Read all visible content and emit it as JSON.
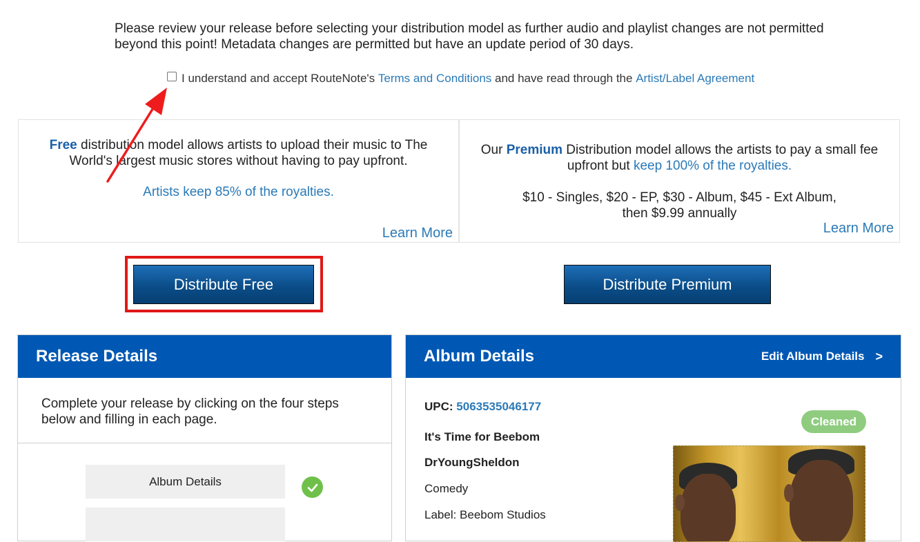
{
  "intro": {
    "line1": "Please review your release before selecting your distribution model as further audio and playlist changes are not permitted",
    "line2": "beyond this point! Metadata changes are permitted but have an update period of 30 days."
  },
  "terms": {
    "text_before": "I understand and accept RouteNote's ",
    "terms_link": "Terms and Conditions",
    "text_middle": " and have read through the ",
    "agreement_link": "Artist/Label Agreement"
  },
  "plans": {
    "free": {
      "name": "Free",
      "desc_line1": " distribution model allows artists to upload their music to The",
      "desc_line2": "World's largest music stores without having to pay upfront.",
      "royalty_text": "Artists keep 85% of the royalties.",
      "learn_more": "Learn More"
    },
    "premium": {
      "prefix": "Our ",
      "name": "Premium",
      "desc_line1": " Distribution model allows the artists to pay a small fee",
      "desc_line2_plain": "upfront but ",
      "desc_line2_link": "keep 100% of the royalties.",
      "pricing_line1": "$10 - Singles, $20 - EP, $30 - Album, $45 - Ext Album,",
      "pricing_line2": "then $9.99 annually",
      "learn_more": "Learn More"
    }
  },
  "buttons": {
    "distribute_free": "Distribute Free",
    "distribute_premium": "Distribute Premium"
  },
  "release_details": {
    "title": "Release Details",
    "intro_line1": "Complete your release by clicking on the four steps",
    "intro_line2": "below and filling in each page.",
    "steps": [
      {
        "label": "Album Details",
        "complete": true
      },
      {
        "label": "",
        "complete": false
      }
    ]
  },
  "album_details": {
    "title": "Album Details",
    "edit_label": "Edit Album Details",
    "edit_chevron": ">",
    "upc_label": "UPC: ",
    "upc_value": "5063535046177",
    "album_title": "It's Time for Beebom",
    "artist": "DrYoungSheldon",
    "genre": "Comedy",
    "label": "Label: Beebom Studios",
    "status_badge": "Cleaned"
  },
  "colors": {
    "header_blue": "#0058b4",
    "link_blue": "#2a7ab8",
    "highlight_red": "#e01818",
    "check_green": "#6fc04b",
    "badge_green": "#8fcc7f"
  },
  "icons": {
    "step_check": "check-circle-icon",
    "annotation": "red-arrow-icon"
  }
}
